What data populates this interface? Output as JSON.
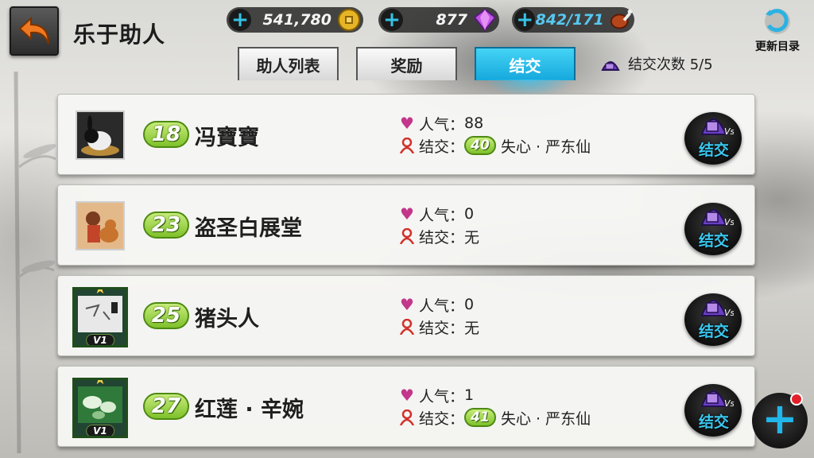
{
  "header": {
    "title": "乐于助人",
    "coins": "541,780",
    "gems": "877",
    "stamina": "842/171",
    "refresh_label": "更新目录"
  },
  "tabs": [
    {
      "label": "助人列表",
      "active": false
    },
    {
      "label": "奖励",
      "active": false
    },
    {
      "label": "结交",
      "active": true
    }
  ],
  "bond_count": "结交次数 5/5",
  "labels": {
    "popularity": "人气：",
    "bond": "结交：",
    "bond_button": "结交"
  },
  "rows": [
    {
      "level": "18",
      "name": "冯寶寶",
      "popularity": "88",
      "bond_level": "40",
      "bond_value": "失心 · 严东仙",
      "vip": false
    },
    {
      "level": "23",
      "name": "盗圣白展堂",
      "popularity": "0",
      "bond_level": "",
      "bond_value": "无",
      "vip": false
    },
    {
      "level": "25",
      "name": "猪头人",
      "popularity": "0",
      "bond_level": "",
      "bond_value": "无",
      "vip": true,
      "vip_label": "V1"
    },
    {
      "level": "27",
      "name": "红莲 · 辛婉",
      "popularity": "1",
      "bond_level": "41",
      "bond_value": "失心 · 严东仙",
      "vip": true,
      "vip_label": "V1"
    }
  ],
  "colors": {
    "accent": "#1fb0e0",
    "level_green": "#7fc12b",
    "heart": "#c2378a",
    "bond_icon": "#d2302a"
  }
}
